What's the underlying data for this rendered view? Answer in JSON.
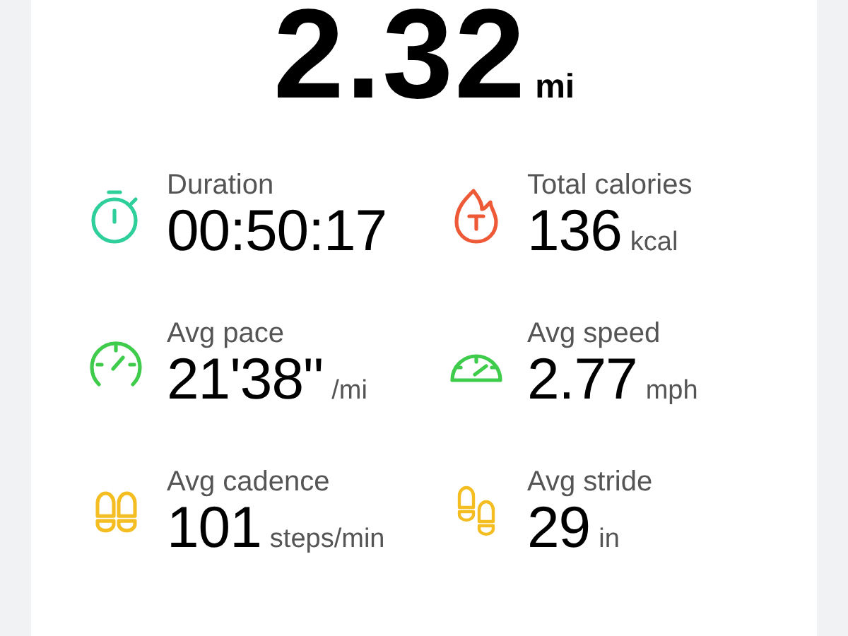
{
  "distance": {
    "value": "2.32",
    "unit": "mi"
  },
  "stats": [
    {
      "label": "Duration",
      "value": "00:50:17",
      "kind": "time"
    },
    {
      "label": "Total calories",
      "value": "136",
      "unit": "kcal",
      "kind": "energy"
    },
    {
      "label": "Avg pace",
      "value": "21'38\"",
      "unit": "/mi",
      "kind": "pace"
    },
    {
      "label": "Avg speed",
      "value": "2.77",
      "unit": "mph",
      "kind": "speed"
    },
    {
      "label": "Avg cadence",
      "value": "101",
      "unit": "steps/min",
      "kind": "cadence"
    },
    {
      "label": "Avg stride",
      "value": "29",
      "unit": "in",
      "kind": "stride"
    }
  ]
}
